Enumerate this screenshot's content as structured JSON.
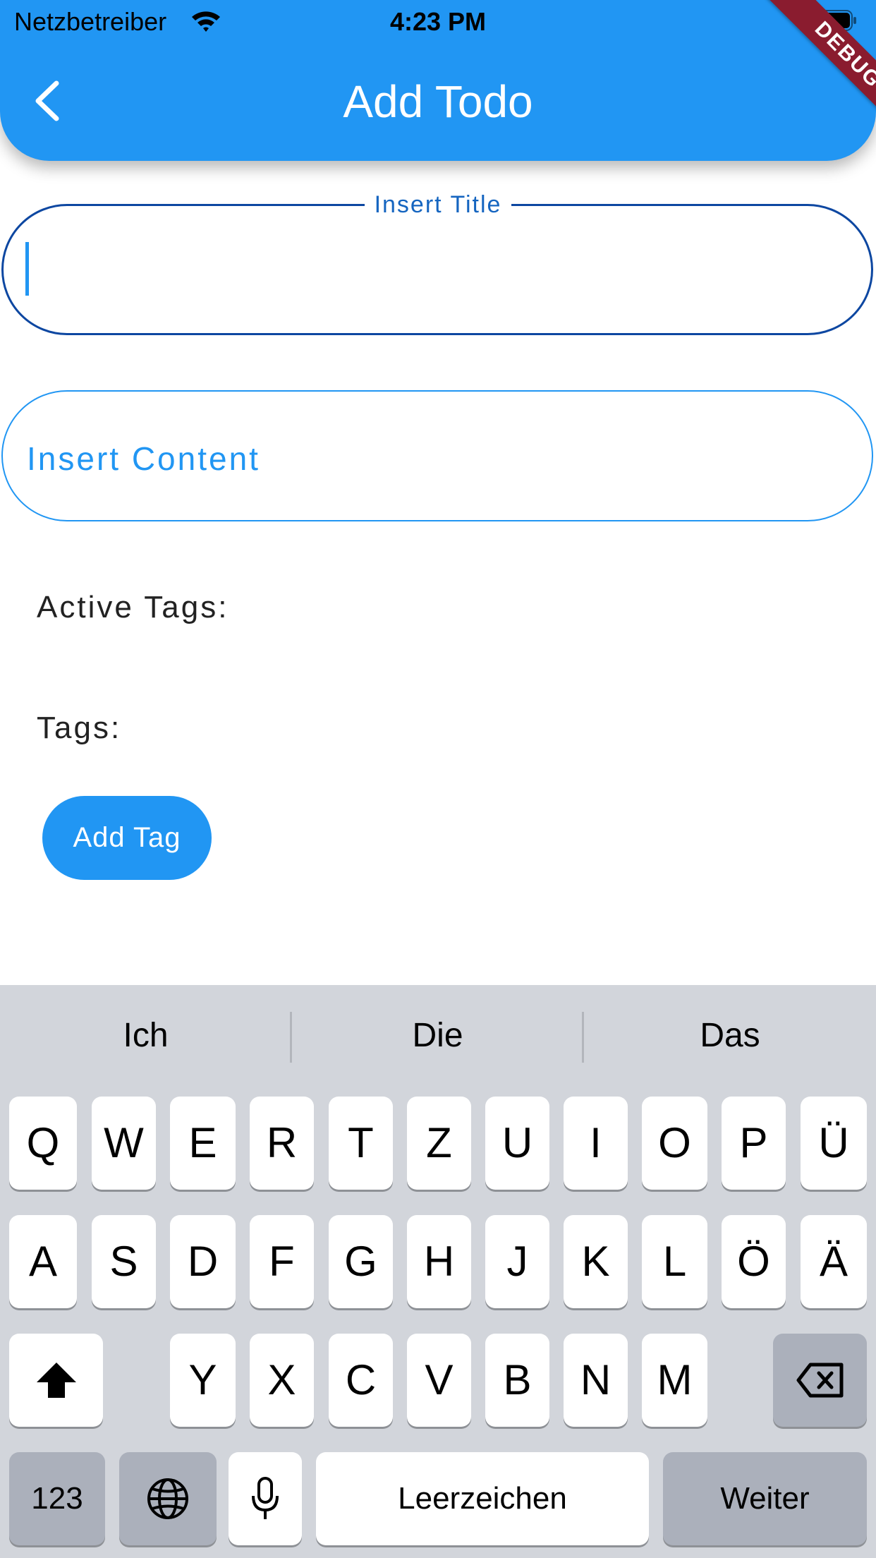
{
  "status_bar": {
    "carrier": "Netzbetreiber",
    "time": "4:23 PM"
  },
  "app_bar": {
    "title": "Add Todo",
    "debug_banner": "DEBUG",
    "color": "#2196f3"
  },
  "form": {
    "title_field": {
      "label": "Insert Title",
      "value": ""
    },
    "content_field": {
      "placeholder": "Insert Content",
      "value": ""
    },
    "active_tags_label": "Active Tags:",
    "tags_label": "Tags:",
    "add_tag_button": "Add Tag"
  },
  "keyboard": {
    "suggestions": [
      "Ich",
      "Die",
      "Das"
    ],
    "row1": [
      "Q",
      "W",
      "E",
      "R",
      "T",
      "Z",
      "U",
      "I",
      "O",
      "P",
      "Ü"
    ],
    "row2": [
      "A",
      "S",
      "D",
      "F",
      "G",
      "H",
      "J",
      "K",
      "L",
      "Ö",
      "Ä"
    ],
    "row3": [
      "Y",
      "X",
      "C",
      "V",
      "B",
      "N",
      "M"
    ],
    "numbers_key": "123",
    "space_key": "Leerzeichen",
    "return_key": "Weiter",
    "icons": [
      "shift-icon",
      "backspace-icon",
      "globe-icon",
      "microphone-icon"
    ]
  }
}
